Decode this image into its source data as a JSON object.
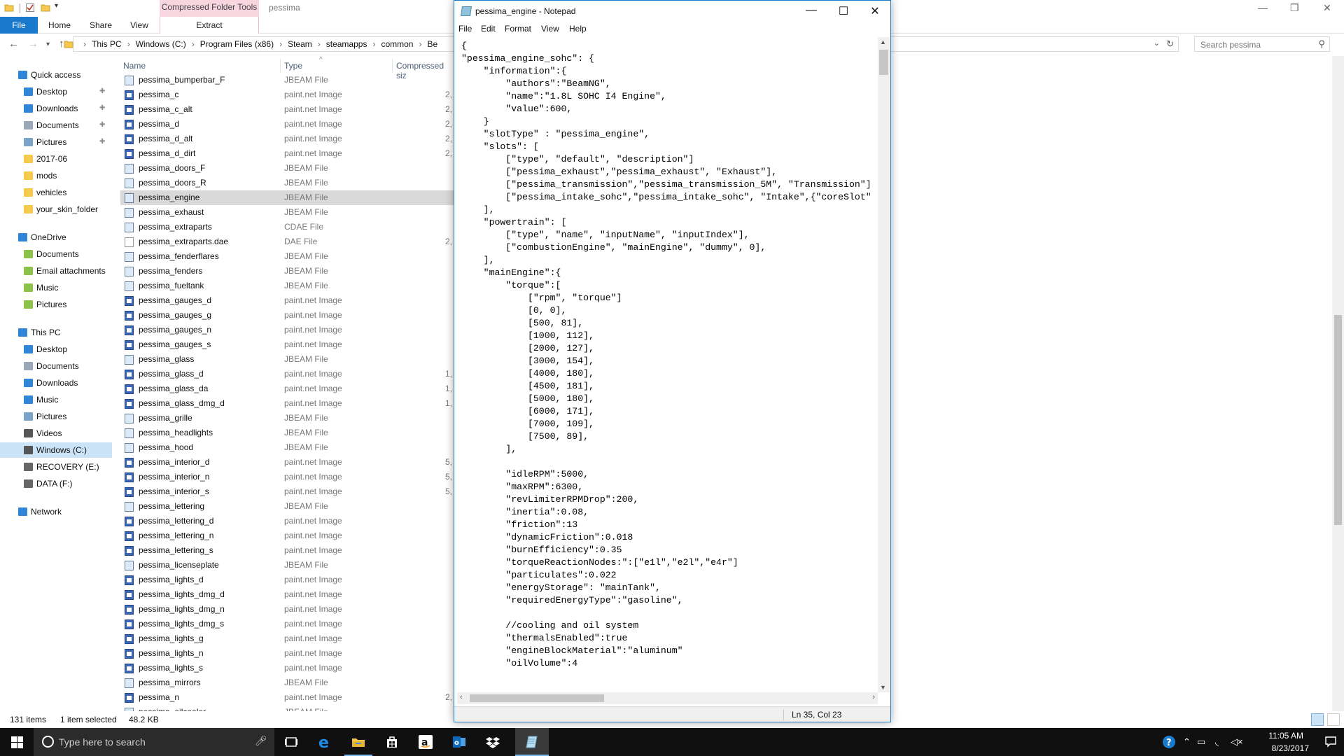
{
  "explorer": {
    "folder_title": "pessima",
    "context_tab_header": "Compressed Folder Tools",
    "tabs": {
      "file": "File",
      "home": "Home",
      "share": "Share",
      "view": "View",
      "extract": "Extract"
    },
    "breadcrumbs": [
      "This PC",
      "Windows (C:)",
      "Program Files (x86)",
      "Steam",
      "steamapps",
      "common",
      "Be"
    ],
    "search_placeholder": "Search pessima",
    "columns": {
      "name": "Name",
      "type": "Type",
      "compressed_size": "Compressed siz"
    },
    "nav": {
      "quick_access": "Quick access",
      "qa_items": [
        "Desktop",
        "Downloads",
        "Documents",
        "Pictures",
        "2017-06",
        "mods",
        "vehicles",
        "your_skin_folder"
      ],
      "onedrive": "OneDrive",
      "od_items": [
        "Documents",
        "Email attachments",
        "Music",
        "Pictures"
      ],
      "this_pc": "This PC",
      "pc_items": [
        "Desktop",
        "Documents",
        "Downloads",
        "Music",
        "Pictures",
        "Videos",
        "Windows (C:)",
        "RECOVERY (E:)",
        "DATA (F:)"
      ],
      "network": "Network"
    },
    "files": [
      {
        "name": "pessima_bumperbar_F",
        "type": "JBEAM File",
        "size": ""
      },
      {
        "name": "pessima_c",
        "type": "paint.net Image",
        "size": "2,"
      },
      {
        "name": "pessima_c_alt",
        "type": "paint.net Image",
        "size": "2,"
      },
      {
        "name": "pessima_d",
        "type": "paint.net Image",
        "size": "2,"
      },
      {
        "name": "pessima_d_alt",
        "type": "paint.net Image",
        "size": "2,"
      },
      {
        "name": "pessima_d_dirt",
        "type": "paint.net Image",
        "size": "2,"
      },
      {
        "name": "pessima_doors_F",
        "type": "JBEAM File",
        "size": ""
      },
      {
        "name": "pessima_doors_R",
        "type": "JBEAM File",
        "size": ""
      },
      {
        "name": "pessima_engine",
        "type": "JBEAM File",
        "size": ""
      },
      {
        "name": "pessima_exhaust",
        "type": "JBEAM File",
        "size": ""
      },
      {
        "name": "pessima_extraparts",
        "type": "CDAE File",
        "size": ""
      },
      {
        "name": "pessima_extraparts.dae",
        "type": "DAE File",
        "size": "2,"
      },
      {
        "name": "pessima_fenderflares",
        "type": "JBEAM File",
        "size": ""
      },
      {
        "name": "pessima_fenders",
        "type": "JBEAM File",
        "size": ""
      },
      {
        "name": "pessima_fueltank",
        "type": "JBEAM File",
        "size": ""
      },
      {
        "name": "pessima_gauges_d",
        "type": "paint.net Image",
        "size": ""
      },
      {
        "name": "pessima_gauges_g",
        "type": "paint.net Image",
        "size": ""
      },
      {
        "name": "pessima_gauges_n",
        "type": "paint.net Image",
        "size": ""
      },
      {
        "name": "pessima_gauges_s",
        "type": "paint.net Image",
        "size": ""
      },
      {
        "name": "pessima_glass",
        "type": "JBEAM File",
        "size": ""
      },
      {
        "name": "pessima_glass_d",
        "type": "paint.net Image",
        "size": "1,"
      },
      {
        "name": "pessima_glass_da",
        "type": "paint.net Image",
        "size": "1,"
      },
      {
        "name": "pessima_glass_dmg_d",
        "type": "paint.net Image",
        "size": "1,"
      },
      {
        "name": "pessima_grille",
        "type": "JBEAM File",
        "size": ""
      },
      {
        "name": "pessima_headlights",
        "type": "JBEAM File",
        "size": ""
      },
      {
        "name": "pessima_hood",
        "type": "JBEAM File",
        "size": ""
      },
      {
        "name": "pessima_interior_d",
        "type": "paint.net Image",
        "size": "5,"
      },
      {
        "name": "pessima_interior_n",
        "type": "paint.net Image",
        "size": "5,"
      },
      {
        "name": "pessima_interior_s",
        "type": "paint.net Image",
        "size": "5,"
      },
      {
        "name": "pessima_lettering",
        "type": "JBEAM File",
        "size": ""
      },
      {
        "name": "pessima_lettering_d",
        "type": "paint.net Image",
        "size": ""
      },
      {
        "name": "pessima_lettering_n",
        "type": "paint.net Image",
        "size": ""
      },
      {
        "name": "pessima_lettering_s",
        "type": "paint.net Image",
        "size": ""
      },
      {
        "name": "pessima_licenseplate",
        "type": "JBEAM File",
        "size": ""
      },
      {
        "name": "pessima_lights_d",
        "type": "paint.net Image",
        "size": ""
      },
      {
        "name": "pessima_lights_dmg_d",
        "type": "paint.net Image",
        "size": ""
      },
      {
        "name": "pessima_lights_dmg_n",
        "type": "paint.net Image",
        "size": ""
      },
      {
        "name": "pessima_lights_dmg_s",
        "type": "paint.net Image",
        "size": ""
      },
      {
        "name": "pessima_lights_g",
        "type": "paint.net Image",
        "size": ""
      },
      {
        "name": "pessima_lights_n",
        "type": "paint.net Image",
        "size": ""
      },
      {
        "name": "pessima_lights_s",
        "type": "paint.net Image",
        "size": ""
      },
      {
        "name": "pessima_mirrors",
        "type": "JBEAM File",
        "size": ""
      },
      {
        "name": "pessima_n",
        "type": "paint.net Image",
        "size": "2,"
      },
      {
        "name": "pessima_oilcooler",
        "type": "JBEAM File",
        "size": ""
      }
    ],
    "selected_file": "pessima_engine",
    "status": {
      "items": "131 items",
      "selected": "1 item selected",
      "size": "48.2 KB"
    }
  },
  "notepad": {
    "title": "pessima_engine - Notepad",
    "menu": [
      "File",
      "Edit",
      "Format",
      "View",
      "Help"
    ],
    "status_position": "Ln 35, Col 23",
    "lines": [
      "{",
      "\"pessima_engine_sohc\": {",
      "    \"information\":{",
      "        \"authors\":\"BeamNG\",",
      "        \"name\":\"1.8L SOHC I4 Engine\",",
      "        \"value\":600,",
      "    }",
      "    \"slotType\" : \"pessima_engine\",",
      "    \"slots\": [",
      "        [\"type\", \"default\", \"description\"]",
      "        [\"pessima_exhaust\",\"pessima_exhaust\", \"Exhaust\"],",
      "        [\"pessima_transmission\",\"pessima_transmission_5M\", \"Transmission\"]",
      "        [\"pessima_intake_sohc\",\"pessima_intake_sohc\", \"Intake\",{\"coreSlot\"",
      "    ],",
      "    \"powertrain\": [",
      "        [\"type\", \"name\", \"inputName\", \"inputIndex\"],",
      "        [\"combustionEngine\", \"mainEngine\", \"dummy\", 0],",
      "    ],",
      "    \"mainEngine\":{",
      "        \"torque\":[",
      "            [\"rpm\", \"torque\"]",
      "            [0, 0],",
      "            [500, 81],",
      "            [1000, 112],",
      "            [2000, 127],",
      "            [3000, 154],",
      "            [4000, 180],",
      "            [4500, 181],",
      "            [5000, 180],",
      "            [6000, 171],",
      "            [7000, 109],",
      "            [7500, 89],",
      "        ],",
      "",
      "        \"idleRPM\":5000,",
      "        \"maxRPM\":6300,",
      "        \"revLimiterRPMDrop\":200,",
      "        \"inertia\":0.08,",
      "        \"friction\":13",
      "        \"dynamicFriction\":0.018",
      "        \"burnEfficiency\":0.35",
      "        \"torqueReactionNodes:\":[\"e1l\",\"e2l\",\"e4r\"]",
      "        \"particulates\":0.022",
      "        \"energyStorage\": \"mainTank\",",
      "        \"requiredEnergyType\":\"gasoline\",",
      "",
      "        //cooling and oil system",
      "        \"thermalsEnabled\":true",
      "        \"engineBlockMaterial\":\"aluminum\"",
      "        \"oilVolume\":4"
    ]
  },
  "taskbar": {
    "search_placeholder": "Type here to search",
    "time": "11:05 AM",
    "date": "8/23/2017"
  },
  "colors": {
    "accent": "#1979ca",
    "taskbar": "#101010",
    "selection": "#d9d9d9"
  }
}
